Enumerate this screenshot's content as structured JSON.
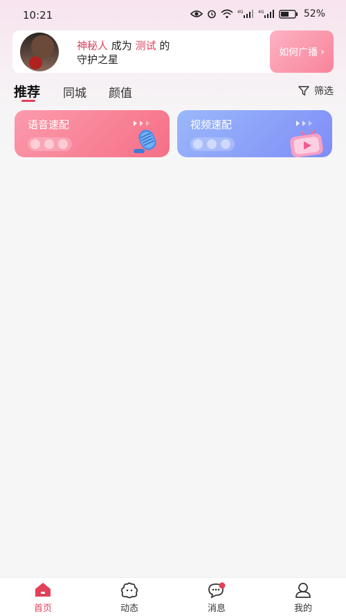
{
  "status_bar": {
    "time": "10:21",
    "battery": "52%"
  },
  "banner": {
    "user_name": "神秘人",
    "middle": "成为",
    "target_name": "测试",
    "suffix": "的",
    "line2": "守护之星",
    "button_label": "如何广播",
    "button_chevron": "›"
  },
  "tabs": [
    {
      "label": "推荐",
      "active": true
    },
    {
      "label": "同城",
      "active": false
    },
    {
      "label": "颜值",
      "active": false
    }
  ],
  "filter_label": "筛选",
  "cards": {
    "voice": {
      "label": "语音速配"
    },
    "video": {
      "label": "视频速配"
    }
  },
  "bottom_nav": [
    {
      "label": "首页",
      "icon": "home-icon",
      "active": true
    },
    {
      "label": "动态",
      "icon": "moments-icon",
      "active": false
    },
    {
      "label": "消息",
      "icon": "message-icon",
      "active": false,
      "badge": true
    },
    {
      "label": "我的",
      "icon": "profile-icon",
      "active": false
    }
  ],
  "colors": {
    "accent": "#e2405a",
    "voice_card": "#f66f86",
    "video_card": "#7f8df7"
  }
}
